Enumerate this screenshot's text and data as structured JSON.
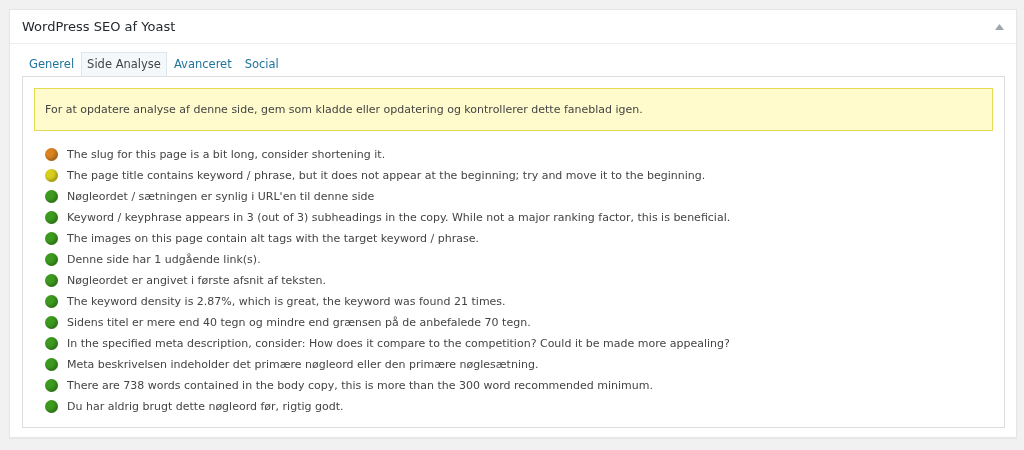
{
  "panel": {
    "title": "WordPress SEO af Yoast",
    "collapsed": false
  },
  "tabs": [
    {
      "label": "Generel",
      "selected": false
    },
    {
      "label": "Side Analyse",
      "selected": true
    },
    {
      "label": "Avanceret",
      "selected": false
    },
    {
      "label": "Social",
      "selected": false
    }
  ],
  "notice": "For at opdatere analyse af denne side, gem som kladde eller opdatering og kontrollerer dette faneblad igen.",
  "results": [
    {
      "text": "The slug for this page is a bit long, consider shortening it.",
      "color": "#d9821e"
    },
    {
      "text": "The page title contains keyword / phrase, but it does not appear at the beginning; try and move it to the beginning.",
      "color": "#d8cf1c"
    },
    {
      "text": "Nøgleordet / sætningen er synlig i URL'en til denne side",
      "color": "#3d9a1e"
    },
    {
      "text": "Keyword / keyphrase appears in 3 (out of 3) subheadings in the copy. While not a major ranking factor, this is beneficial.",
      "color": "#3d9a1e"
    },
    {
      "text": "The images on this page contain alt tags with the target keyword / phrase.",
      "color": "#3d9a1e"
    },
    {
      "text": "Denne side har 1 udgående link(s).",
      "color": "#3d9a1e"
    },
    {
      "text": "Nøgleordet er angivet i første afsnit af teksten.",
      "color": "#3d9a1e"
    },
    {
      "text": "The keyword density is 2.87%, which is great, the keyword was found 21 times.",
      "color": "#3d9a1e"
    },
    {
      "text": "Sidens titel er mere end 40 tegn og mindre end grænsen på de anbefalede 70 tegn.",
      "color": "#3d9a1e"
    },
    {
      "text": "In the specified meta description, consider: How does it compare to the competition? Could it be made more appealing?",
      "color": "#3d9a1e"
    },
    {
      "text": "Meta beskrivelsen indeholder det primære nøgleord eller den primære nøglesætning.",
      "color": "#3d9a1e"
    },
    {
      "text": "There are 738 words contained in the body copy, this is more than the 300 word recommended minimum.",
      "color": "#3d9a1e"
    },
    {
      "text": "Du har aldrig brugt dette nøgleord før, rigtig godt.",
      "color": "#3d9a1e"
    }
  ]
}
